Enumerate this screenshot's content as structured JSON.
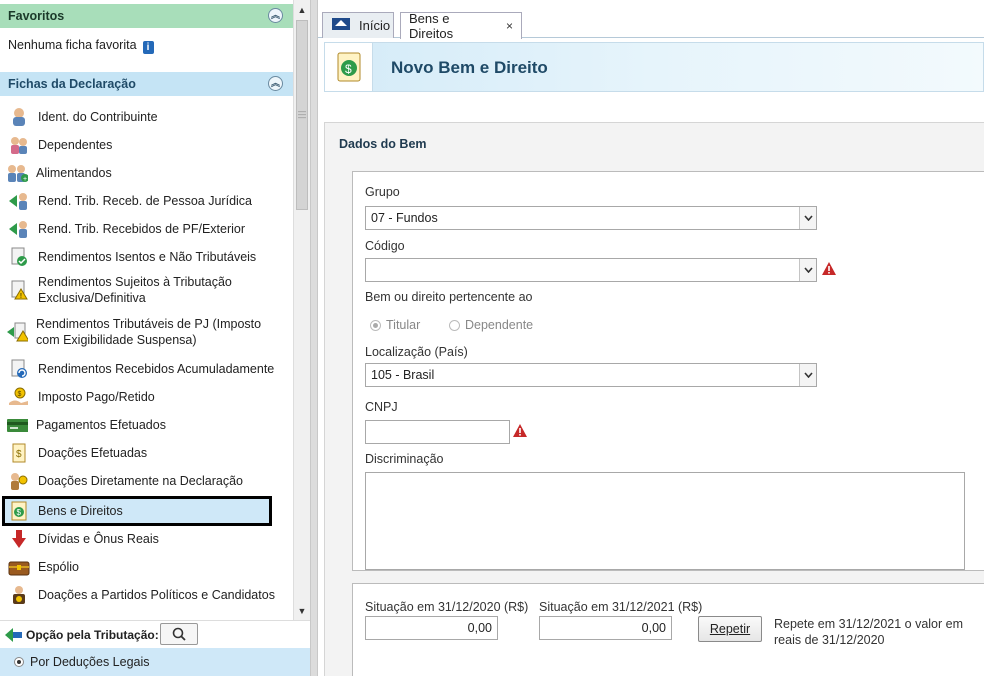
{
  "sidebar": {
    "favoritos_title": "Favoritos",
    "favoritos_empty": "Nenhuma ficha favorita",
    "fichas_title": "Fichas da Declaração",
    "items": [
      {
        "label": "Ident. do Contribuinte",
        "icon": "person-icon"
      },
      {
        "label": "Dependentes",
        "icon": "dependents-icon"
      },
      {
        "label": "Alimentandos",
        "icon": "alimentandos-icon"
      },
      {
        "label": "Rend. Trib. Receb. de Pessoa Jurídica",
        "icon": "income-pj-icon"
      },
      {
        "label": "Rend. Trib. Recebidos de PF/Exterior",
        "icon": "income-pf-icon"
      },
      {
        "label": "Rendimentos Isentos e Não Tributáveis",
        "icon": "exempt-income-icon"
      },
      {
        "label": "Rendimentos Sujeitos à Tributação Exclusiva/Definitiva",
        "icon": "exclusive-tax-icon"
      },
      {
        "label": "Rendimentos Tributáveis de PJ (Imposto com Exigibilidade Suspensa)",
        "icon": "suspended-tax-icon"
      },
      {
        "label": "Rendimentos Recebidos Acumuladamente",
        "icon": "accumulated-income-icon"
      },
      {
        "label": "Imposto Pago/Retido",
        "icon": "tax-paid-icon"
      },
      {
        "label": "Pagamentos Efetuados",
        "icon": "payments-icon"
      },
      {
        "label": "Doações Efetuadas",
        "icon": "donations-icon"
      },
      {
        "label": "Doações Diretamente na Declaração",
        "icon": "direct-donations-icon"
      },
      {
        "label": "Bens e Direitos",
        "icon": "assets-icon"
      },
      {
        "label": "Dívidas e Ônus Reais",
        "icon": "debts-icon"
      },
      {
        "label": "Espólio",
        "icon": "estate-icon"
      },
      {
        "label": "Doações a Partidos Políticos e Candidatos",
        "icon": "political-donations-icon"
      }
    ],
    "opcao_label": "Opção pela Tributação:",
    "deducoes_label": "Por Deduções Legais"
  },
  "tabs": [
    {
      "label": "Início"
    },
    {
      "label": "Bens e Direitos",
      "close": "×"
    }
  ],
  "page": {
    "title": "Novo Bem e Direito"
  },
  "form": {
    "section_title": "Dados do Bem",
    "grupo_label": "Grupo",
    "grupo_value": "07 - Fundos",
    "codigo_label": "Código",
    "codigo_value": "",
    "pertencente_label": "Bem ou direito pertencente ao",
    "titular_label": "Titular",
    "dependente_label": "Dependente",
    "localizacao_label": "Localização (País)",
    "localizacao_value": "105 - Brasil",
    "cnpj_label": "CNPJ",
    "cnpj_value": "",
    "discriminacao_label": "Discriminação",
    "discriminacao_value": ""
  },
  "situacao": {
    "label_2020": "Situação em 31/12/2020 (R$)",
    "value_2020": "0,00",
    "label_2021": "Situação em 31/12/2021 (R$)",
    "value_2021": "0,00",
    "repetir_label": "Repetir",
    "repete_text": "Repete em 31/12/2021 o valor em reais de 31/12/2020"
  },
  "colors": {
    "favoritos_bg": "#a8deba",
    "fichas_bg": "#c5e4f5",
    "selected_bg": "#cfe8f8",
    "title_color": "#1f4a67",
    "warning": "#c62828"
  }
}
